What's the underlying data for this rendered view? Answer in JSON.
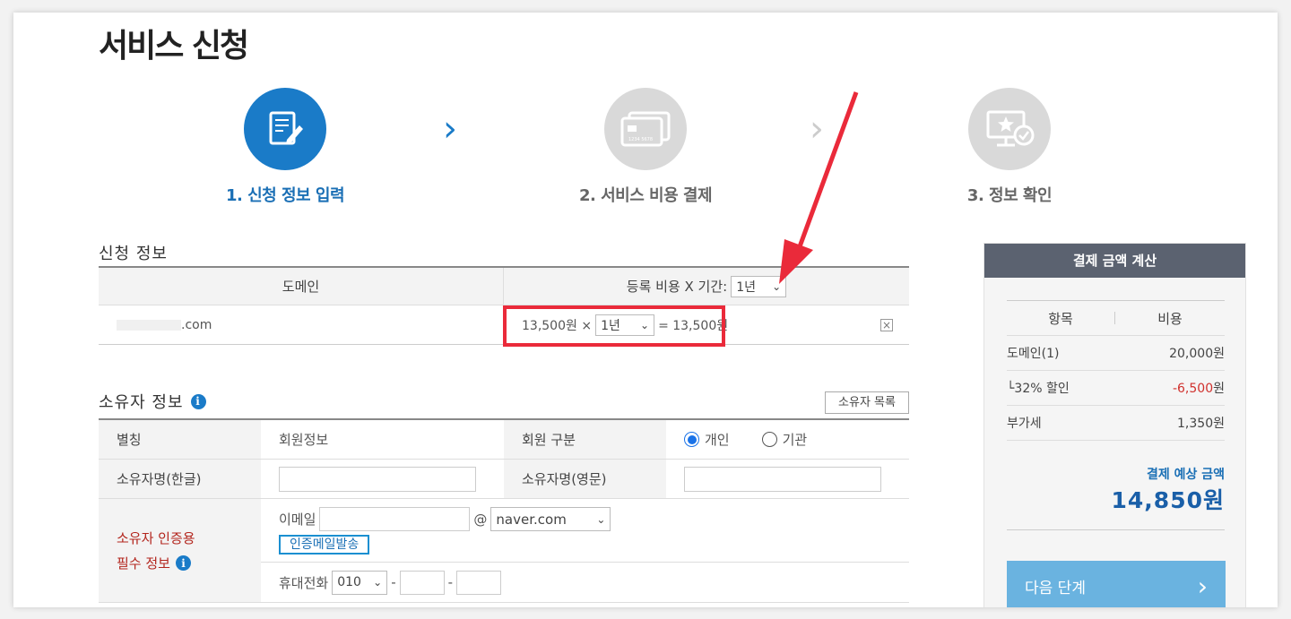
{
  "page_title": "서비스 신청",
  "steps": [
    {
      "label": "1. 신청 정보 입력",
      "icon": "form-edit-icon",
      "state": "active"
    },
    {
      "label": "2. 서비스 비용 결제",
      "icon": "card-icon",
      "state": "inactive"
    },
    {
      "label": "3. 정보 확인",
      "icon": "monitor-check-icon",
      "state": "inactive"
    }
  ],
  "card_icon_number": "1234 5678",
  "application": {
    "section_title": "신청 정보",
    "col_domain": "도메인",
    "col_fee_period": "등록 비용 X 기간:",
    "period_header_value": "1년",
    "domain_suffix": ".com",
    "unit_price": "13,500원 ×",
    "row_period_value": "1년",
    "row_total": "= 13,500원",
    "remove_symbol": "×"
  },
  "owner": {
    "section_title": "소유자 정보",
    "list_button": "소유자 목록",
    "alias_label": "별칭",
    "alias_value": "회원정보",
    "member_type_label": "회원 구분",
    "member_type_options": [
      "개인",
      "기관"
    ],
    "member_type_selected": "개인",
    "name_kr_label": "소유자명(한글)",
    "name_en_label": "소유자명(영문)",
    "auth_label_line1": "소유자 인증용",
    "auth_label_line2": "필수 정보",
    "email_label": "이메일",
    "email_at": "@",
    "email_domain": "naver.com",
    "send_mail_button": "인증메일발송",
    "phone_label": "휴대전화",
    "phone_prefix": "010",
    "phone_dash": "-"
  },
  "calc": {
    "header": "결제 금액 계산",
    "col_item": "항목",
    "col_cost": "비용",
    "rows": [
      {
        "item": "도메인(1)",
        "cost": "20,000",
        "unit": "원",
        "color": "#333333"
      },
      {
        "item": "└32% 할인",
        "cost": "-6,500",
        "unit": "원",
        "color": "#d0312d"
      },
      {
        "item": "부가세",
        "cost": "1,350",
        "unit": "원",
        "color": "#333333"
      }
    ],
    "expected_label": "결제 예상 금액",
    "expected_total": "14,850원",
    "next_button": "다음 단계",
    "next_arrow": "›"
  },
  "colors": {
    "accent_blue": "#1a7bc8",
    "highlight_red": "#ea2a3a",
    "required_red": "#b3261e",
    "panel_header": "#5b6270",
    "next_button": "#6ab3e0"
  }
}
